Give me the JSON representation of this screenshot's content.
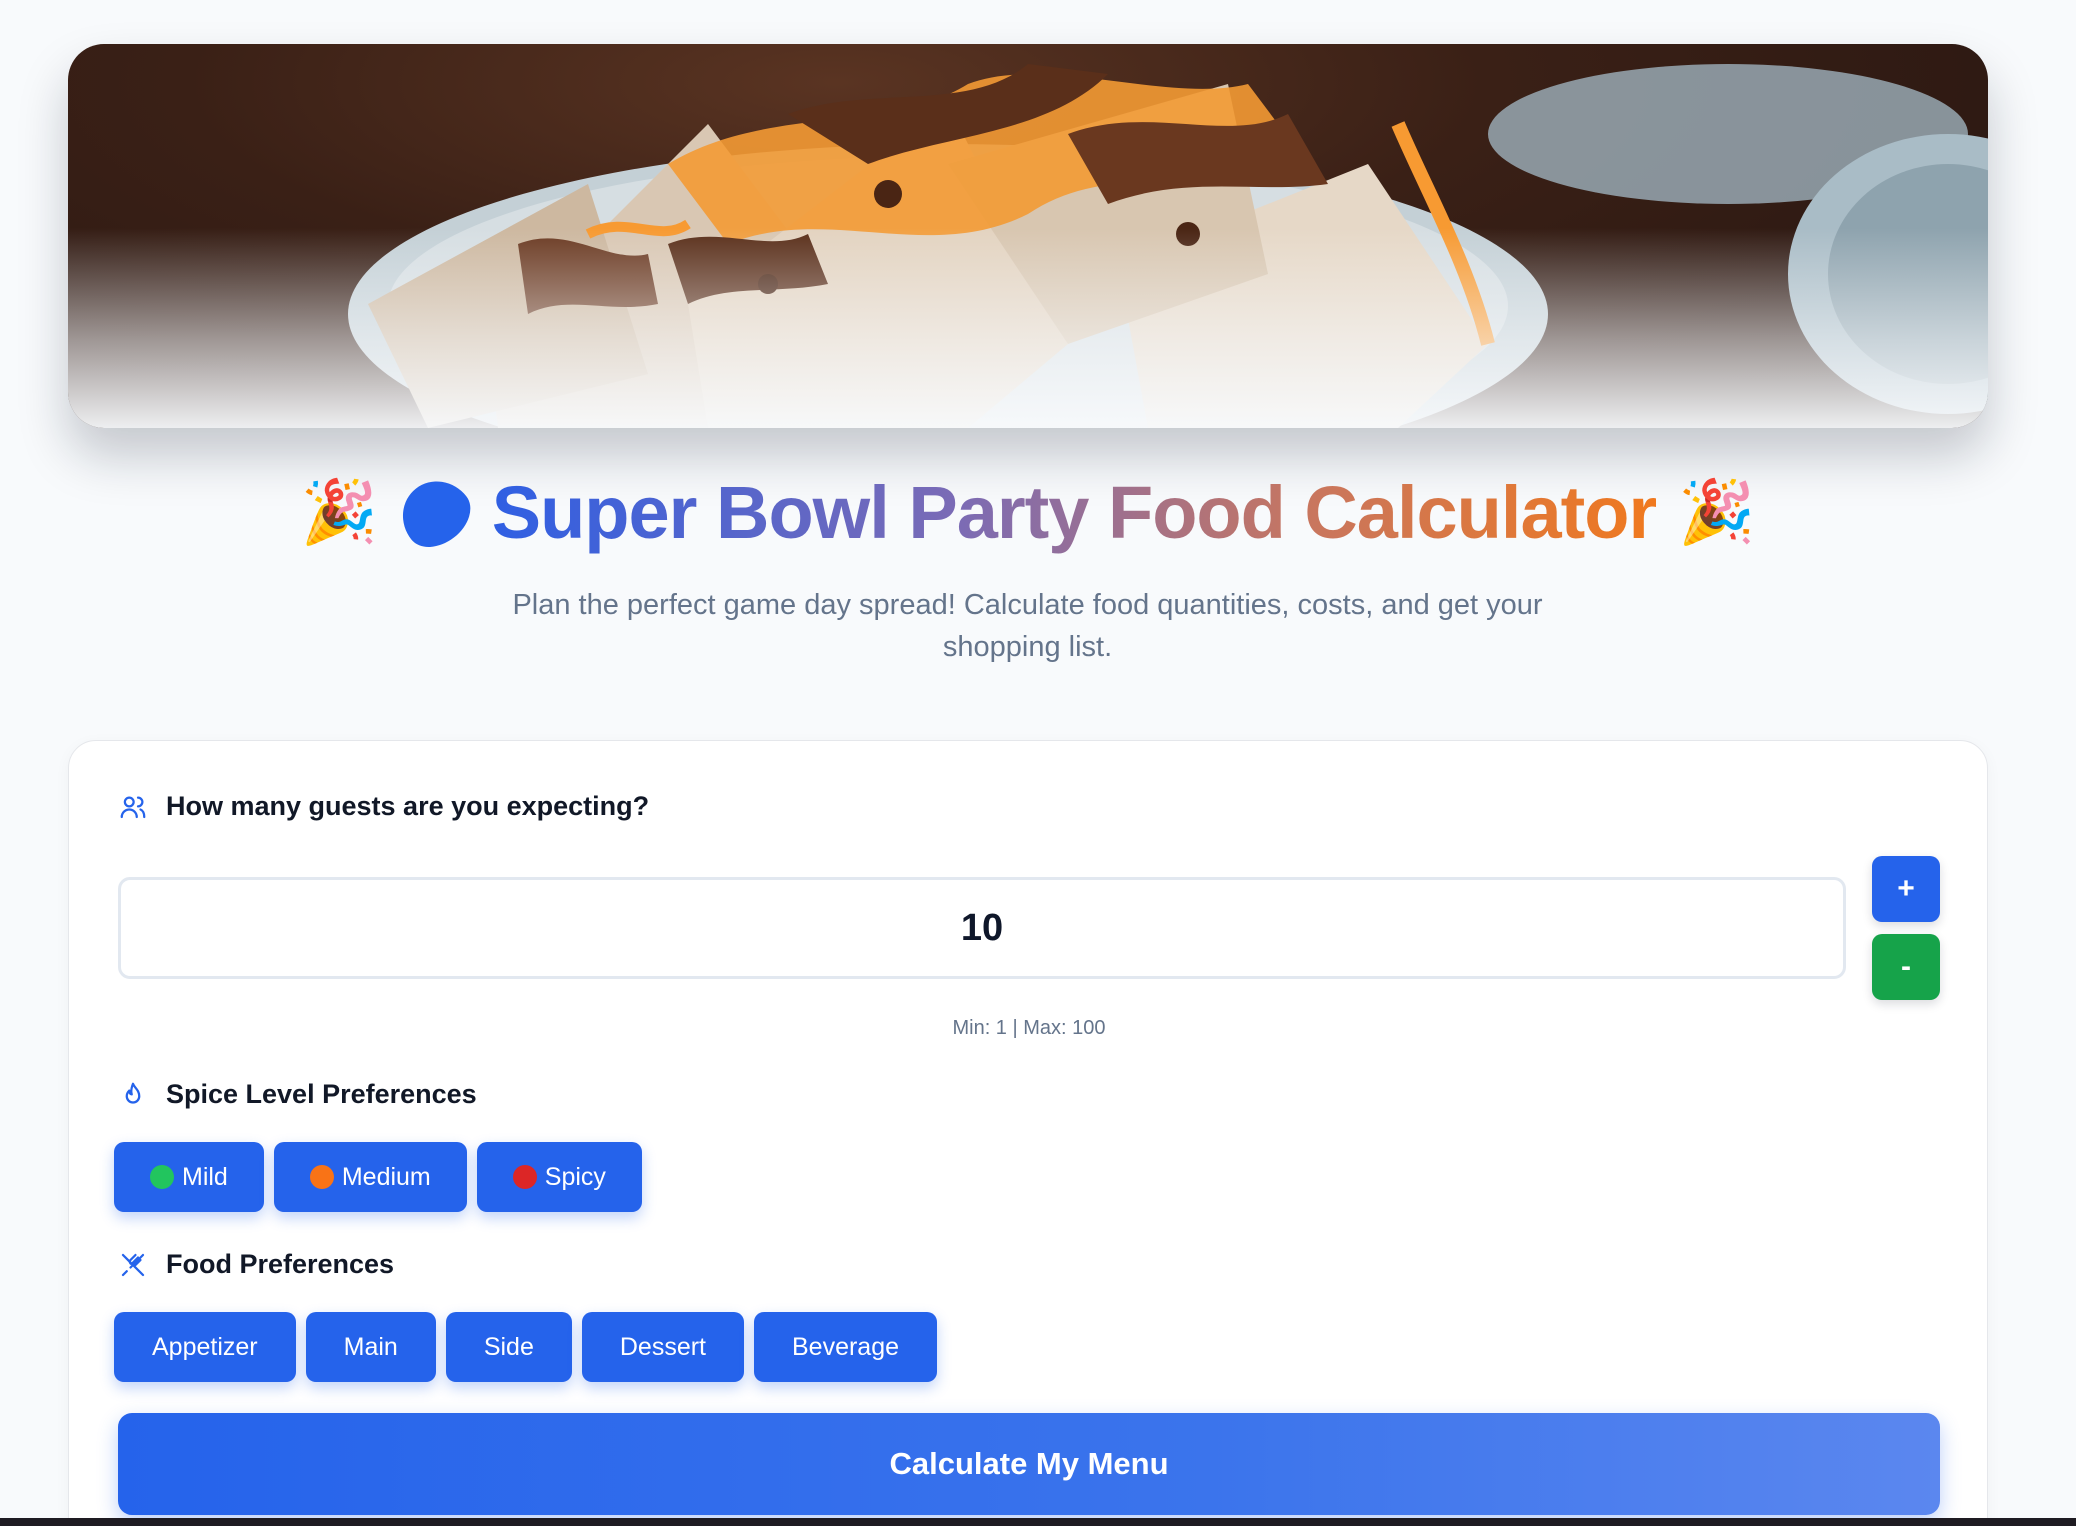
{
  "hero": {
    "image_subject": "nachos-platter-photo"
  },
  "header": {
    "left_emoji": "🎉",
    "right_emoji": "🎉",
    "title": "Super Bowl Party Food Calculator",
    "subtitle": "Plan the perfect game day spread! Calculate food quantities, costs, and get your shopping list."
  },
  "guests": {
    "label": "How many guests are you expecting?",
    "value": "10",
    "plus_label": "+",
    "minus_label": "-",
    "range_hint": "Min: 1 | Max: 100"
  },
  "spice": {
    "label": "Spice Level Preferences",
    "options": [
      {
        "label": "Mild",
        "dot_color": "#22c55e"
      },
      {
        "label": "Medium",
        "dot_color": "#f97316"
      },
      {
        "label": "Spicy",
        "dot_color": "#dc2626"
      }
    ]
  },
  "food": {
    "label": "Food Preferences",
    "options": [
      "Appetizer",
      "Main",
      "Side",
      "Dessert",
      "Beverage"
    ]
  },
  "actions": {
    "calculate_label": "Calculate My Menu"
  },
  "colors": {
    "primary": "#2563eb",
    "success": "#16a34a",
    "accent_orange": "#f0791e"
  }
}
